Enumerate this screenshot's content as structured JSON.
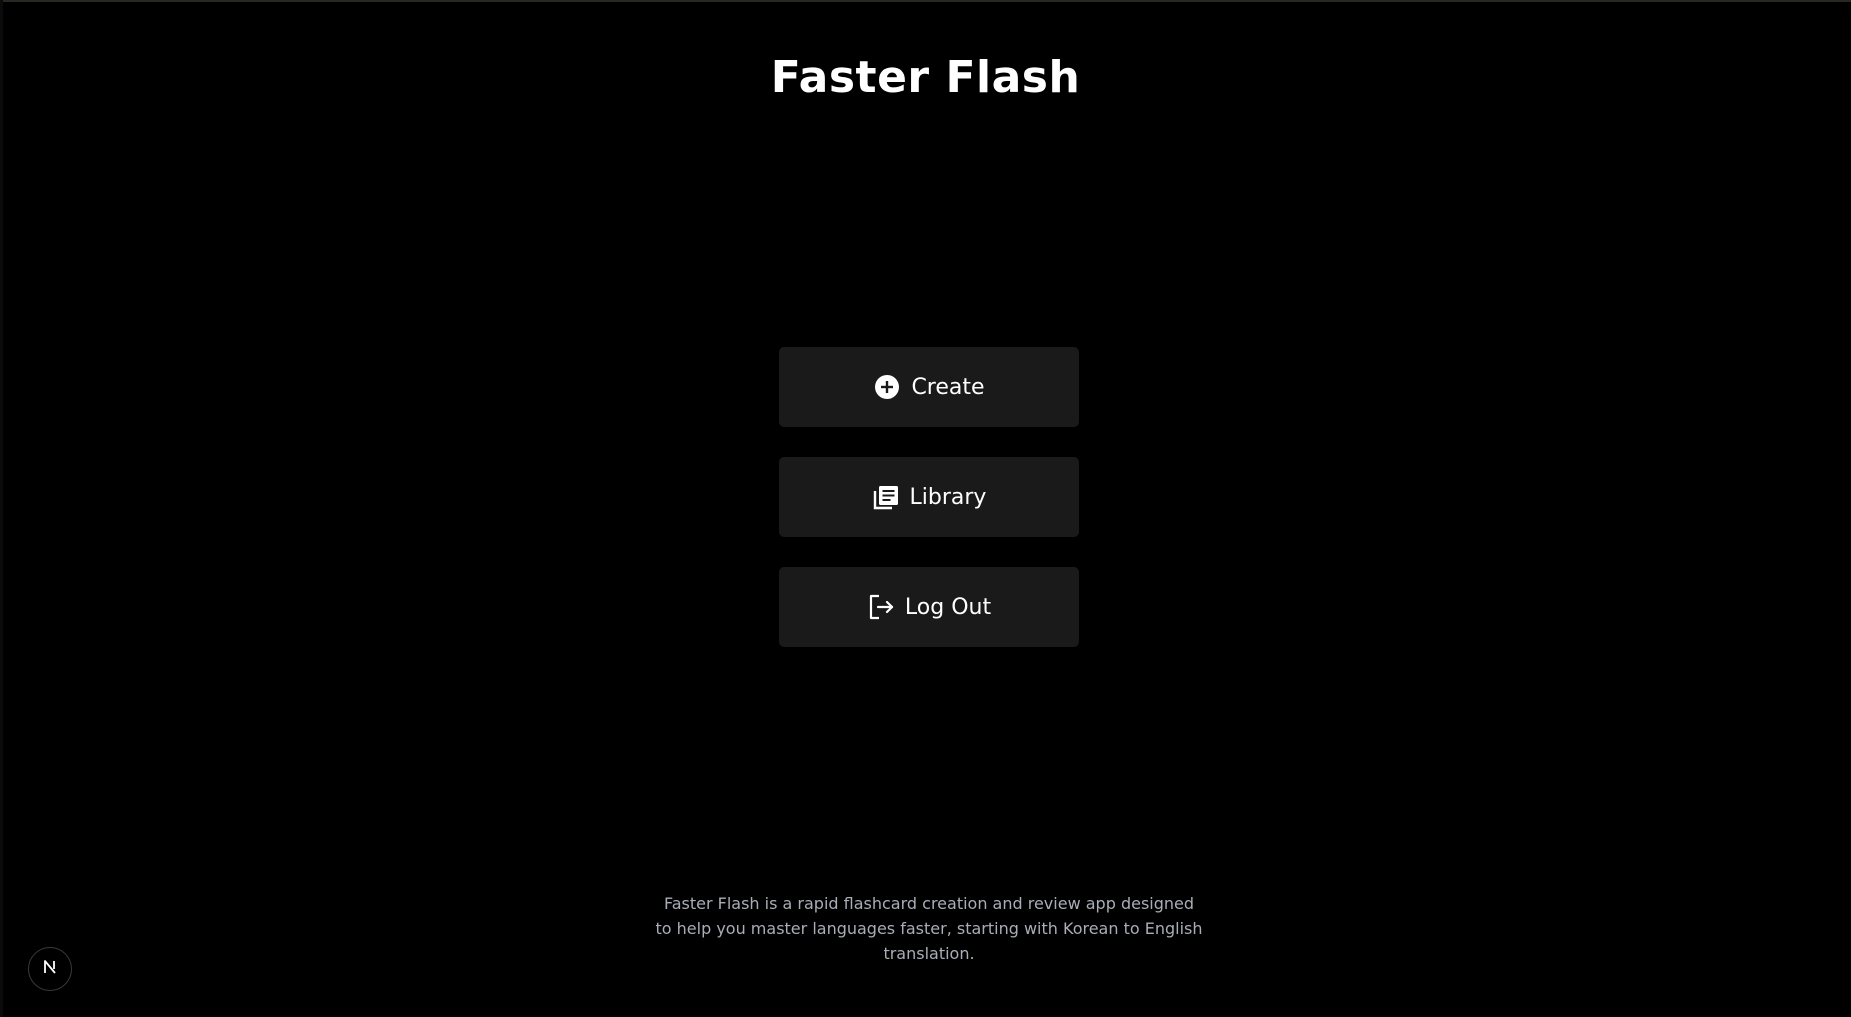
{
  "app": {
    "title": "Faster Flash"
  },
  "menu": {
    "create": {
      "label": "Create",
      "icon": "plus-circle-icon"
    },
    "library": {
      "label": "Library",
      "icon": "library-icon"
    },
    "logout": {
      "label": "Log Out",
      "icon": "logout-icon"
    }
  },
  "footer": {
    "description": "Faster Flash is a rapid flashcard creation and review app designed to help you master languages faster, starting with Korean to English translation."
  },
  "dev_badge": {
    "icon": "nextjs-logo-icon"
  },
  "colors": {
    "background": "#000000",
    "button_background": "#1a1a1a",
    "text": "#ffffff",
    "muted_text": "#a8adb6"
  }
}
